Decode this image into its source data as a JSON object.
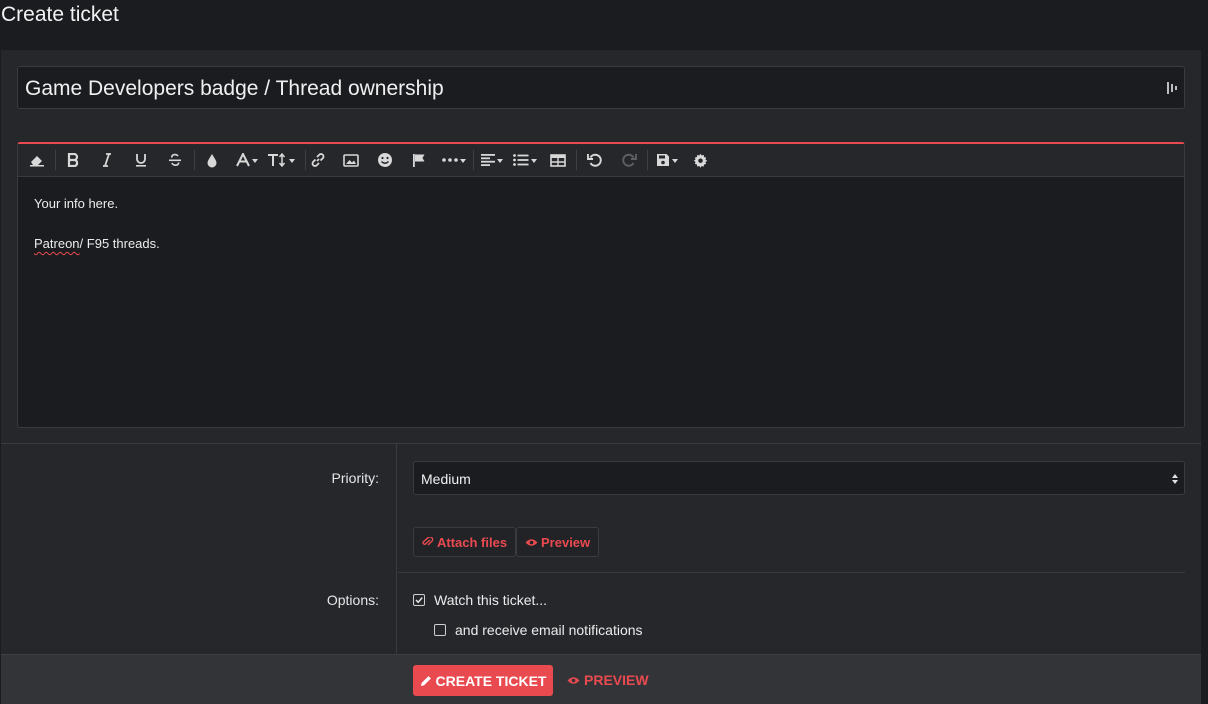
{
  "page": {
    "title": "Create ticket"
  },
  "ticket": {
    "title_value": "Game Developers badge / Thread ownership"
  },
  "editor": {
    "lines": [
      "Your info here.",
      "Patreon",
      "/ F95 threads."
    ]
  },
  "form": {
    "priority_label": "Priority:",
    "priority_value": "Medium",
    "attach_label": "Attach files",
    "preview_label": "Preview",
    "options_label": "Options:",
    "watch_label": "Watch this ticket...",
    "email_label": "and receive email notifications",
    "watch_checked": true,
    "email_checked": false
  },
  "footer": {
    "create_label": "CREATE TICKET",
    "preview_label": "PREVIEW"
  },
  "colors": {
    "accent": "#e94a4f",
    "background": "#1b1c20",
    "panel": "#26272b"
  },
  "icons": {
    "toolbar": [
      "eraser-icon",
      "bold-icon",
      "italic-icon",
      "underline-icon",
      "strikethrough-icon",
      "color-drop-icon",
      "font-family-icon",
      "font-size-icon",
      "link-icon",
      "image-icon",
      "smiley-icon",
      "flag-icon",
      "more-icon",
      "align-icon",
      "list-icon",
      "table-icon",
      "undo-icon",
      "redo-icon",
      "save-draft-icon",
      "settings-icon"
    ]
  }
}
